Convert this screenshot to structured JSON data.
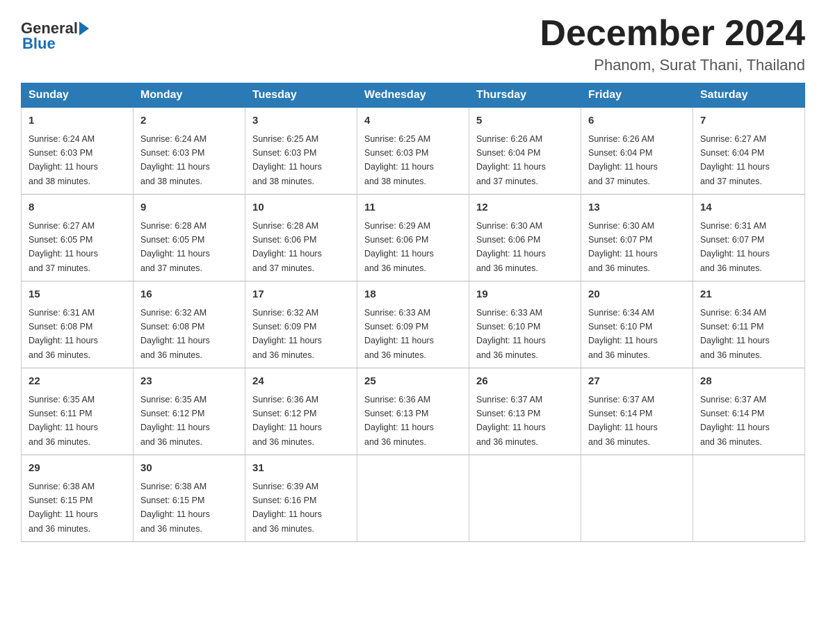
{
  "header": {
    "logo_line1": "General",
    "logo_line2": "Blue",
    "month_title": "December 2024",
    "location": "Phanom, Surat Thani, Thailand"
  },
  "days_of_week": [
    "Sunday",
    "Monday",
    "Tuesday",
    "Wednesday",
    "Thursday",
    "Friday",
    "Saturday"
  ],
  "weeks": [
    [
      {
        "day": "1",
        "sunrise": "6:24 AM",
        "sunset": "6:03 PM",
        "daylight": "11 hours and 38 minutes."
      },
      {
        "day": "2",
        "sunrise": "6:24 AM",
        "sunset": "6:03 PM",
        "daylight": "11 hours and 38 minutes."
      },
      {
        "day": "3",
        "sunrise": "6:25 AM",
        "sunset": "6:03 PM",
        "daylight": "11 hours and 38 minutes."
      },
      {
        "day": "4",
        "sunrise": "6:25 AM",
        "sunset": "6:03 PM",
        "daylight": "11 hours and 38 minutes."
      },
      {
        "day": "5",
        "sunrise": "6:26 AM",
        "sunset": "6:04 PM",
        "daylight": "11 hours and 37 minutes."
      },
      {
        "day": "6",
        "sunrise": "6:26 AM",
        "sunset": "6:04 PM",
        "daylight": "11 hours and 37 minutes."
      },
      {
        "day": "7",
        "sunrise": "6:27 AM",
        "sunset": "6:04 PM",
        "daylight": "11 hours and 37 minutes."
      }
    ],
    [
      {
        "day": "8",
        "sunrise": "6:27 AM",
        "sunset": "6:05 PM",
        "daylight": "11 hours and 37 minutes."
      },
      {
        "day": "9",
        "sunrise": "6:28 AM",
        "sunset": "6:05 PM",
        "daylight": "11 hours and 37 minutes."
      },
      {
        "day": "10",
        "sunrise": "6:28 AM",
        "sunset": "6:06 PM",
        "daylight": "11 hours and 37 minutes."
      },
      {
        "day": "11",
        "sunrise": "6:29 AM",
        "sunset": "6:06 PM",
        "daylight": "11 hours and 36 minutes."
      },
      {
        "day": "12",
        "sunrise": "6:30 AM",
        "sunset": "6:06 PM",
        "daylight": "11 hours and 36 minutes."
      },
      {
        "day": "13",
        "sunrise": "6:30 AM",
        "sunset": "6:07 PM",
        "daylight": "11 hours and 36 minutes."
      },
      {
        "day": "14",
        "sunrise": "6:31 AM",
        "sunset": "6:07 PM",
        "daylight": "11 hours and 36 minutes."
      }
    ],
    [
      {
        "day": "15",
        "sunrise": "6:31 AM",
        "sunset": "6:08 PM",
        "daylight": "11 hours and 36 minutes."
      },
      {
        "day": "16",
        "sunrise": "6:32 AM",
        "sunset": "6:08 PM",
        "daylight": "11 hours and 36 minutes."
      },
      {
        "day": "17",
        "sunrise": "6:32 AM",
        "sunset": "6:09 PM",
        "daylight": "11 hours and 36 minutes."
      },
      {
        "day": "18",
        "sunrise": "6:33 AM",
        "sunset": "6:09 PM",
        "daylight": "11 hours and 36 minutes."
      },
      {
        "day": "19",
        "sunrise": "6:33 AM",
        "sunset": "6:10 PM",
        "daylight": "11 hours and 36 minutes."
      },
      {
        "day": "20",
        "sunrise": "6:34 AM",
        "sunset": "6:10 PM",
        "daylight": "11 hours and 36 minutes."
      },
      {
        "day": "21",
        "sunrise": "6:34 AM",
        "sunset": "6:11 PM",
        "daylight": "11 hours and 36 minutes."
      }
    ],
    [
      {
        "day": "22",
        "sunrise": "6:35 AM",
        "sunset": "6:11 PM",
        "daylight": "11 hours and 36 minutes."
      },
      {
        "day": "23",
        "sunrise": "6:35 AM",
        "sunset": "6:12 PM",
        "daylight": "11 hours and 36 minutes."
      },
      {
        "day": "24",
        "sunrise": "6:36 AM",
        "sunset": "6:12 PM",
        "daylight": "11 hours and 36 minutes."
      },
      {
        "day": "25",
        "sunrise": "6:36 AM",
        "sunset": "6:13 PM",
        "daylight": "11 hours and 36 minutes."
      },
      {
        "day": "26",
        "sunrise": "6:37 AM",
        "sunset": "6:13 PM",
        "daylight": "11 hours and 36 minutes."
      },
      {
        "day": "27",
        "sunrise": "6:37 AM",
        "sunset": "6:14 PM",
        "daylight": "11 hours and 36 minutes."
      },
      {
        "day": "28",
        "sunrise": "6:37 AM",
        "sunset": "6:14 PM",
        "daylight": "11 hours and 36 minutes."
      }
    ],
    [
      {
        "day": "29",
        "sunrise": "6:38 AM",
        "sunset": "6:15 PM",
        "daylight": "11 hours and 36 minutes."
      },
      {
        "day": "30",
        "sunrise": "6:38 AM",
        "sunset": "6:15 PM",
        "daylight": "11 hours and 36 minutes."
      },
      {
        "day": "31",
        "sunrise": "6:39 AM",
        "sunset": "6:16 PM",
        "daylight": "11 hours and 36 minutes."
      },
      null,
      null,
      null,
      null
    ]
  ],
  "labels": {
    "sunrise": "Sunrise:",
    "sunset": "Sunset:",
    "daylight": "Daylight:"
  }
}
